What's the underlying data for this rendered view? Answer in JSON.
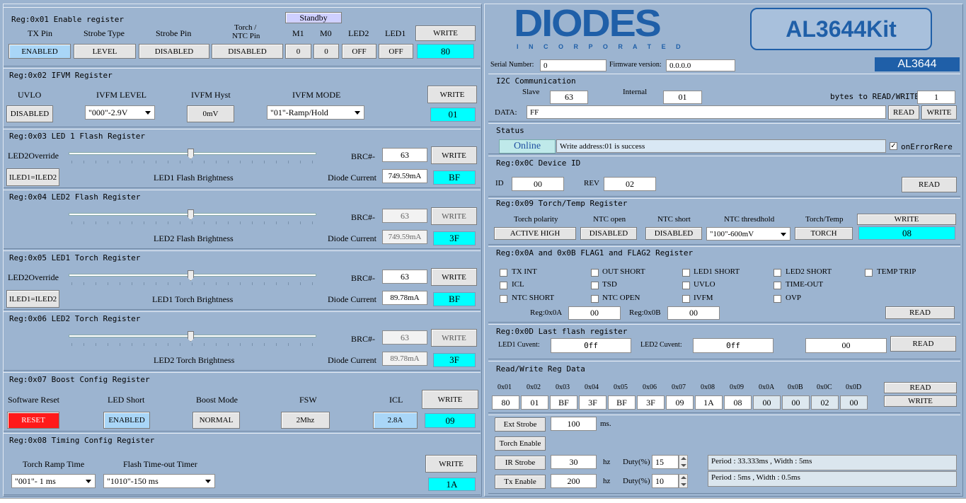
{
  "left": {
    "reg01": {
      "title": "Reg:0x01 Enable register",
      "standby": "Standby",
      "cols": [
        "TX Pin",
        "Strobe Type",
        "Strobe Pin",
        "Torch /",
        "NTC Pin",
        "M1",
        "M0",
        "LED2",
        "LED1"
      ],
      "vals": [
        "ENABLED",
        "LEVEL",
        "DISABLED",
        "DISABLED",
        "0",
        "0",
        "OFF",
        "OFF"
      ],
      "write": "WRITE",
      "hex": "80"
    },
    "reg02": {
      "title": "Reg:0x02 IFVM Register",
      "uvlo": "UVLO",
      "uvlo_val": "DISABLED",
      "level": "IVFM LEVEL",
      "level_val": "\"000\"-2.9V",
      "hyst": "IVFM Hyst",
      "hyst_val": "0mV",
      "mode": "IVFM MODE",
      "mode_val": "\"01\"-Ramp/Hold",
      "write": "WRITE",
      "hex": "01"
    },
    "reg03": {
      "title": "Reg:0x03 LED 1 Flash Register",
      "override": "LED2Override",
      "btn": "ILED1=ILED2",
      "center": "LED1 Flash Brightness",
      "brc": "BRC#-",
      "brc_val": "63",
      "dc": "Diode Current",
      "dc_val": "749.59mA",
      "write": "WRITE",
      "hex": "BF"
    },
    "reg04": {
      "title": "Reg:0x04 LED2 Flash Register",
      "center": "LED2 Flash Brightness",
      "brc": "BRC#-",
      "brc_val": "63",
      "dc": "Diode Current",
      "dc_val": "749.59mA",
      "write": "WRITE",
      "hex": "3F"
    },
    "reg05": {
      "title": "Reg:0x05 LED1 Torch Register",
      "override": "LED2Override",
      "btn": "ILED1=ILED2",
      "center": "LED1 Torch Brightness",
      "brc": "BRC#-",
      "brc_val": "63",
      "dc": "Diode Current",
      "dc_val": "89.78mA",
      "write": "WRITE",
      "hex": "BF"
    },
    "reg06": {
      "title": "Reg:0x06 LED2 Torch Register",
      "center": "LED2 Torch Brightness",
      "brc": "BRC#-",
      "brc_val": "63",
      "dc": "Diode Current",
      "dc_val": "89.78mA",
      "write": "WRITE",
      "hex": "3F"
    },
    "reg07": {
      "title": "Reg:0x07 Boost Config Register",
      "sr": "Software Reset",
      "sr_val": "RESET",
      "ls": "LED Short",
      "ls_val": "ENABLED",
      "bm": "Boost Mode",
      "bm_val": "NORMAL",
      "fsw": "FSW",
      "fsw_val": "2Mhz",
      "icl": "ICL",
      "icl_val": "2.8A",
      "write": "WRITE",
      "hex": "09"
    },
    "reg08": {
      "title": "Reg:0x08 Timing Config Register",
      "trt": "Torch Ramp Time",
      "trt_val": "\"001\"- 1 ms",
      "fto": "Flash Time-out Timer",
      "fto_val": "\"1010\"-150 ms",
      "write": "WRITE",
      "hex": "1A"
    }
  },
  "right": {
    "logo": "DIODES",
    "logo_sub": "I N C O R P O R A T E D",
    "kit": "AL3644Kit",
    "chip": "AL3644",
    "serial_lbl": "Serial Number:",
    "serial": "0",
    "fw_lbl": "Firmware version:",
    "fw": "0.0.0.0",
    "i2c": {
      "title": "I2C Communication",
      "slave": "Slave",
      "slave_val": "63",
      "internal": "Internal",
      "internal_val": "01",
      "bytes": "bytes to READ/WRITE",
      "bytes_val": "1",
      "data": "DATA:",
      "data_val": "FF",
      "read": "READ",
      "write": "WRITE"
    },
    "status": {
      "title": "Status",
      "online": "Online",
      "msg": "Write address:01 is success",
      "chk": "onErrorRere"
    },
    "dev": {
      "title": "Reg:0x0C Device ID",
      "id": "ID",
      "id_val": "00",
      "rev": "REV",
      "rev_val": "02",
      "read": "READ"
    },
    "torch": {
      "title": "Reg:0x09 Torch/Temp Register",
      "cols": [
        "Torch polarity",
        "NTC open",
        "NTC short",
        "NTC thresdhold",
        "Torch/Temp"
      ],
      "vals": [
        "ACTIVE HIGH",
        "DISABLED",
        "DISABLED",
        "\"100\"-600mV",
        "TORCH"
      ],
      "write": "WRITE",
      "hex": "08"
    },
    "flag": {
      "title": "Reg:0x0A and 0x0B FLAG1 and FLAG2 Register",
      "items": [
        "TX INT",
        "OUT SHORT",
        "LED1 SHORT",
        "LED2 SHORT",
        "TEMP TRIP",
        "ICL",
        "TSD",
        "UVLO",
        "TIME-OUT",
        "NTC SHORT",
        "NTC OPEN",
        "IVFM",
        "OVP"
      ],
      "a_lbl": "Reg:0x0A",
      "a_val": "00",
      "b_lbl": "Reg:0x0B",
      "b_val": "00",
      "read": "READ"
    },
    "last": {
      "title": "Reg:0x0D Last flash register",
      "l1": "LED1 Cuvent:",
      "l1_val": "0ff",
      "l2": "LED2 Cuvent:",
      "l2_val": "0ff",
      "v": "00",
      "read": "READ"
    },
    "rw": {
      "title": "Read/Write Reg Data",
      "hdr": [
        "0x01",
        "0x02",
        "0x03",
        "0x04",
        "0x05",
        "0x06",
        "0x07",
        "0x08",
        "0x09",
        "0x0A",
        "0x0B",
        "0x0C",
        "0x0D"
      ],
      "vals": [
        "80",
        "01",
        "BF",
        "3F",
        "BF",
        "3F",
        "09",
        "1A",
        "08",
        "00",
        "00",
        "02",
        "00"
      ],
      "read": "READ",
      "write": "WRITE"
    },
    "strobe": {
      "ext": "Ext Strobe",
      "ext_val": "100",
      "ms": "ms.",
      "torch_en": "Torch Enable",
      "ir": "IR Strobe",
      "ir_val": "30",
      "hz1": "hz",
      "duty1": "Duty(%)",
      "duty1_val": "15",
      "tx": "Tx Enable",
      "tx_val": "200",
      "hz2": "hz",
      "duty2": "Duty(%)",
      "duty2_val": "10",
      "p1": "Period : 33.333ms , Width : 5ms",
      "p2": "Period : 5ms , Width : 0.5ms"
    }
  }
}
